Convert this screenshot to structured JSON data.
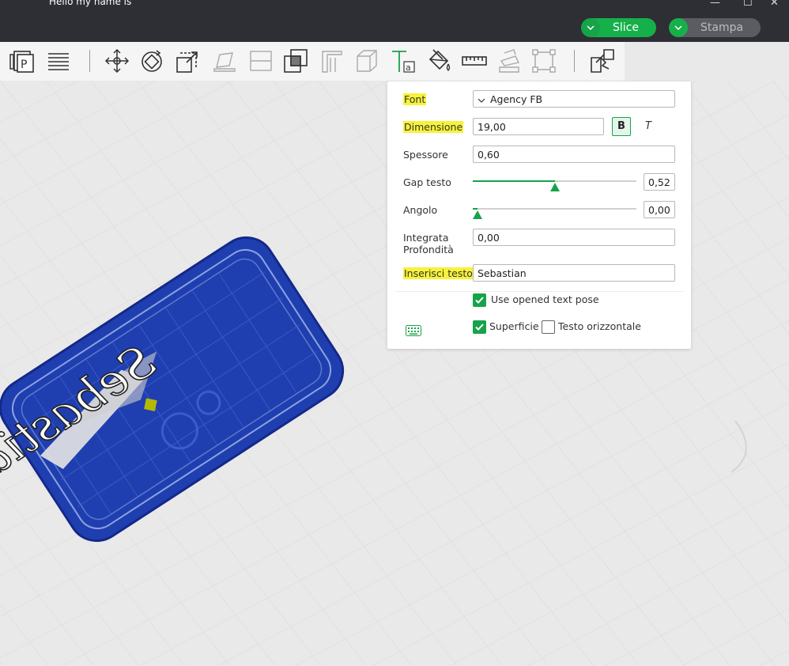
{
  "window": {
    "title": "Hello my name is"
  },
  "header": {
    "slice_label": "Slice",
    "print_label": "Stampa"
  },
  "toolbar": {
    "tools": [
      "page-icon",
      "plate-icon",
      "layers-icon",
      "move-icon",
      "rotate-icon",
      "scale-icon",
      "place-face-icon",
      "cut-icon",
      "boolean-icon",
      "support-icon",
      "seam-icon",
      "text-icon",
      "paint-icon",
      "measure-icon",
      "assemble-icon",
      "arrange-icon",
      "split-icon"
    ]
  },
  "text_panel": {
    "font_label": "Font",
    "font_value": "Agency FB",
    "size_label": "Dimensione",
    "size_value": "19,00",
    "bold_label": "B",
    "italic_label": "T",
    "thickness_label": "Spessore",
    "thickness_value": "0,60",
    "gap_label": "Gap testo",
    "gap_value": "0,52",
    "gap_fraction": 0.5,
    "angle_label": "Angolo",
    "angle_value": "0,00",
    "angle_fraction": 0.03,
    "depth_label_1": "Integrata",
    "depth_label_2": "Profondità",
    "depth_value": "0,00",
    "text_label": "Inserisci testo",
    "text_value": "Sebastian",
    "use_opened_label": "Use opened text pose",
    "use_opened_checked": true,
    "surface_label": "Superficie",
    "surface_checked": true,
    "horizontal_label": "Testo orizzontale",
    "horizontal_checked": false
  },
  "colors": {
    "accent": "#16a34a",
    "plate": "#1f3fb0",
    "highlight": "#f7f23a"
  }
}
